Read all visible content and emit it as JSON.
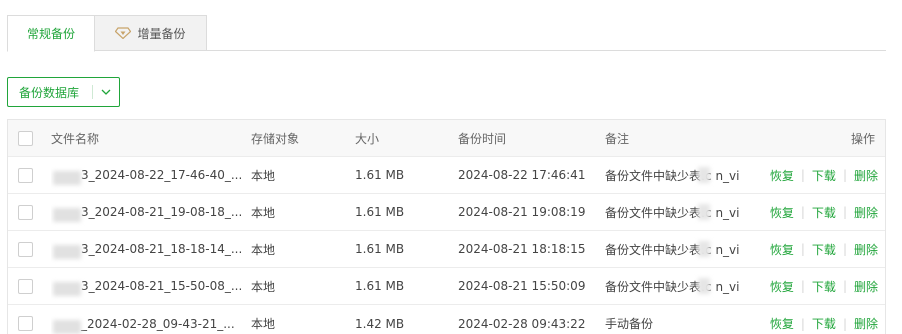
{
  "tabs": [
    {
      "label": "常规备份",
      "active": true
    },
    {
      "label": "增量备份",
      "icon": "gem-icon",
      "active": false
    }
  ],
  "dropdown": {
    "label": "备份数据库",
    "icon": "chevron-down-icon"
  },
  "table": {
    "headers": {
      "name": "文件名称",
      "storage": "存储对象",
      "size": "大小",
      "time": "备份时间",
      "note": "备注",
      "ops": "操作"
    },
    "rows": [
      {
        "name": "3_2024-08-22_17-46-40_...",
        "storage": "本地",
        "size": "1.61 MB",
        "time": "2024-08-22 17:46:41",
        "note": "备份文件中缺少表:c n_vi"
      },
      {
        "name": "3_2024-08-21_19-08-18_...",
        "storage": "本地",
        "size": "1.61 MB",
        "time": "2024-08-21 19:08:19",
        "note": "备份文件中缺少表:c n_vi"
      },
      {
        "name": "3_2024-08-21_18-18-14_...",
        "storage": "本地",
        "size": "1.61 MB",
        "time": "2024-08-21 18:18:15",
        "note": "备份文件中缺少表:c n_vi"
      },
      {
        "name": "3_2024-08-21_15-50-08_...",
        "storage": "本地",
        "size": "1.61 MB",
        "time": "2024-08-21 15:50:09",
        "note": "备份文件中缺少表:c n_vi"
      },
      {
        "name": "_2024-02-28_09-43-21_...",
        "storage": "本地",
        "size": "1.42 MB",
        "time": "2024-02-28 09:43:22",
        "note": "手动备份"
      }
    ],
    "ops": {
      "restore": "恢复",
      "download": "下载",
      "delete": "删除",
      "separator": "|"
    }
  },
  "colors": {
    "accent": "#20a53a",
    "border": "#dcdcdc",
    "header_bg": "#f8f8f8"
  }
}
